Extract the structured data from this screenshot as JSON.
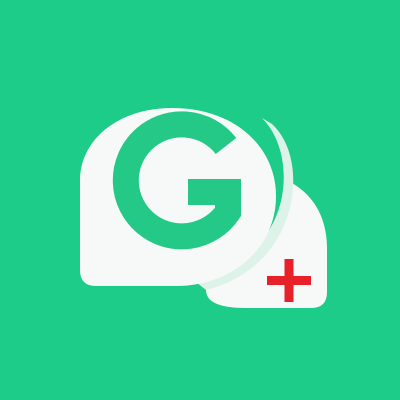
{
  "app_icon": {
    "logo_letter": "G",
    "icon_name": "chat-bubble-medical-cross-icon",
    "colors": {
      "background": "#1ECC8A",
      "bubble": "#F7F9F8",
      "bubble_shadow": "#DDF3EA",
      "letter": "#24C987",
      "cross": "#E8202A"
    }
  }
}
